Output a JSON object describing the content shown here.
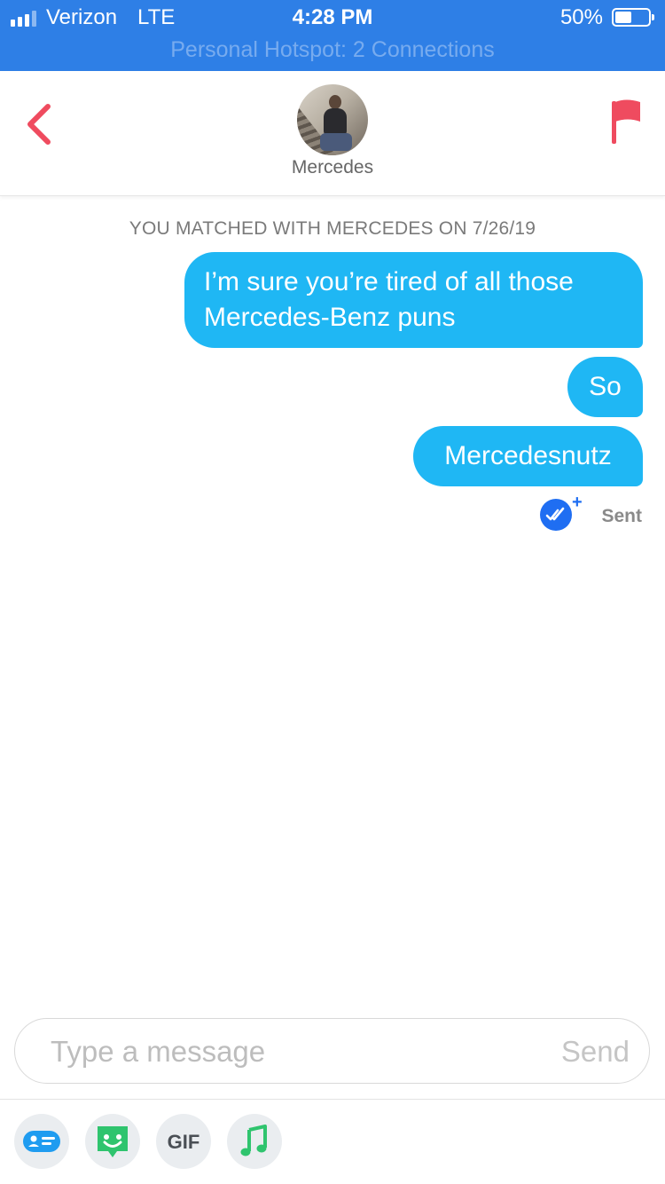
{
  "status_bar": {
    "carrier": "Verizon",
    "network": "LTE",
    "time": "4:28 PM",
    "battery_percent": "50%",
    "battery_level": 0.5,
    "hotspot": "Personal Hotspot: 2 Connections",
    "bar_color": "#2e7fe6"
  },
  "header": {
    "match_name": "Mercedes",
    "back_icon": "chevron-left-icon",
    "report_icon": "flag-icon",
    "accent": "#ef4b5f"
  },
  "chat": {
    "match_notice": "YOU MATCHED WITH MERCEDES ON 7/26/19",
    "messages": [
      {
        "text": "I’m sure you’re tired of all those Mercedes-Benz puns",
        "from": "me"
      },
      {
        "text": "So",
        "from": "me"
      },
      {
        "text": "Mercedesnutz",
        "from": "me"
      }
    ],
    "status_label": "Sent",
    "bubble_color": "#1fb7f4"
  },
  "composer": {
    "placeholder": "Type a message",
    "send_label": "Send"
  },
  "toolbar": {
    "items": [
      {
        "icon": "contact-card-icon"
      },
      {
        "icon": "sticker-face-icon"
      },
      {
        "label": "GIF"
      },
      {
        "icon": "music-note-icon"
      }
    ]
  }
}
